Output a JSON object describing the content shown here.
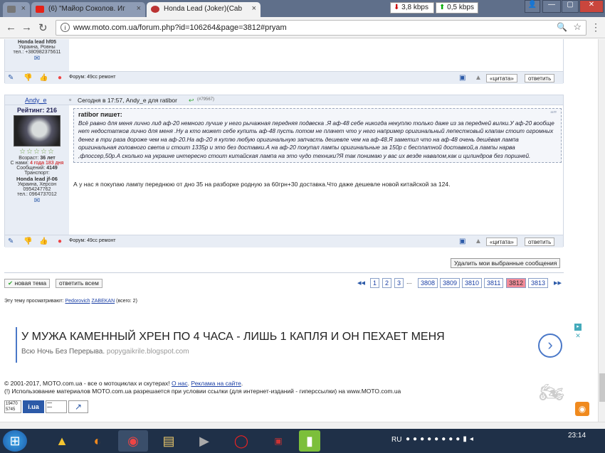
{
  "browser": {
    "tabs": [
      {
        "label": ""
      },
      {
        "label": "(6) \"Майор Соколов. Иг"
      },
      {
        "label": "Honda Lead (Joker)(Cab"
      }
    ],
    "net_down": "3,8 kbps",
    "net_up": "0,5 kbps",
    "url": "www.moto.com.ua/forum.php?id=106264&page=3812#pryam"
  },
  "top_post": {
    "bike": "Honda lead hf05",
    "location": "Украина, Ровны",
    "phone": "тел.: +380982375611",
    "forum": "Форум: 49сс ремонт",
    "quote_label": "«цитата»",
    "reply_label": "ответить"
  },
  "post": {
    "author": "Andy_e",
    "rating": "Рейтинг: 216",
    "header": "Сегодня в 17:57, Andy_e для ratibor",
    "header_id": "(#79567)",
    "age_label": "Возраст:",
    "age": "36 лет",
    "since_label": "С нами:",
    "since": "4 года 183 дня",
    "msgs_label": "Сообщений:",
    "msgs": "4149",
    "transport_label": "Транспорт:",
    "bike": "Honda lead jf-06",
    "location": "Украина, Херсон",
    "phone1": "0954247762",
    "phone2": "тел.: 0964737012",
    "quote_author": "ratibor пишет:",
    "quote_text": "Всё равно для меня лично лид аф-20 немного лучше у него рычажная передняя подвеска .Я аф-48 себе никогда некуплю только даже из за передней вилки.У аф-20 вообще нет недостатков лично для меня .Ну а кто может себе купить аф-48 пусть потом не плачет что у него например оригинальный лепестковый клапан стоит огромных денег в три раза дороже чем на аф-20.На аф-20 я куплю любую оригинальную запчасть дешевле чем на аф-48.Я заметил что на аф-48 очень дешёвая лампа оригинальная головного света и стоит 1335р и это без доставки.А на аф-20 покупал лампы оригинальные за 150р с бесплатной доставкой,а лампы нарва ,флоссер,50р.А сколько на украине интересно стоит китайская лампа на это чудо техники?Я так понимаю у вас их везде навалом,как и цилиндров без поршней.",
    "body": "А у нас я покупаю лампу переднюю от дно 35 на разборке родную за 60грн+30 доставка.Что даже дешевле новой китайской за 124.",
    "forum": "Форум: 49сс ремонт",
    "quote_label": "«цитата»",
    "reply_label": "ответить"
  },
  "delete_selected": "Удалить мои выбранные сообщения",
  "new_topic": "новая тема",
  "reply_all": "ответить всем",
  "pager": [
    "1",
    "2",
    "3",
    "...",
    "3808",
    "3809",
    "3810",
    "3811",
    "3812",
    "3813"
  ],
  "viewers_label": "Эту тему просматривают:",
  "viewers": [
    "Pedorovich",
    "ZABEKAN"
  ],
  "viewers_total": "(всего: 2)",
  "ad": {
    "headline": "У МУЖА КАМЕННЫЙ ХРЕН ПО 4 ЧАСА - ЛИШЬ 1 КАПЛЯ И ОН ПЕХАЕТ МЕНЯ",
    "sub": "Всю Ночь Без Перерыва.",
    "domain": "popygaikrile.blogspot.com"
  },
  "footer": {
    "copy": "© 2001-2017, MOTO.com.ua - все о мотоциклах и скутерах!",
    "about": "О нас",
    "ads": "Реклама на сайте",
    "notice": "(!) Использование материалов MOTO.com.ua разрешается при условии ссылки (для интернет-изданий - гиперссылки) на www.MOTO.com.ua",
    "counter1": "19470",
    "counter2": "5745"
  },
  "taskbar": {
    "lang": "RU",
    "time": "23:14"
  }
}
